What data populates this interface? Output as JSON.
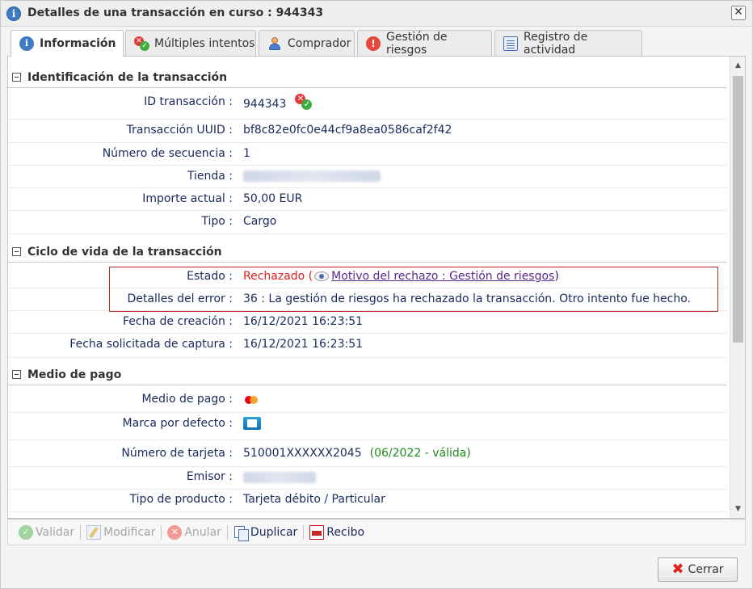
{
  "window": {
    "title": "Detalles de una transacción en curso : 944343",
    "close_symbol": "✕"
  },
  "tabs": [
    {
      "label": "Información"
    },
    {
      "label": "Múltiples intentos"
    },
    {
      "label": "Comprador"
    },
    {
      "label": "Gestión de riesgos"
    },
    {
      "label": "Registro de actividad"
    }
  ],
  "sections": {
    "identification": {
      "title": "Identificación de la transacción",
      "rows": [
        {
          "label": "ID transacción",
          "value": "944343"
        },
        {
          "label": "Transacción UUID",
          "value": "bf8c82e0fc0e44cf9a8ea0586caf2f42"
        },
        {
          "label": "Número de secuencia",
          "value": "1"
        },
        {
          "label": "Tienda",
          "value": ""
        },
        {
          "label": "Importe actual",
          "value": "50,00 EUR"
        },
        {
          "label": "Tipo",
          "value": "Cargo"
        }
      ]
    },
    "lifecycle": {
      "title": "Ciclo de vida de la transacción",
      "rows": [
        {
          "label": "Estado",
          "value": "Rechazado",
          "paren_open": " (",
          "link": "Motivo del rechazo : Gestión de riesgos",
          "paren_close": ")"
        },
        {
          "label": "Detalles del error",
          "value": "36 : La gestión de riesgos ha rechazado la transacción. Otro intento fue hecho."
        },
        {
          "label": "Fecha de creación",
          "value": "16/12/2021 16:23:51"
        },
        {
          "label": "Fecha solicitada de captura",
          "value": "16/12/2021 16:23:51"
        }
      ]
    },
    "payment": {
      "title": "Medio de pago",
      "rows": [
        {
          "label": "Medio de pago",
          "value": ""
        },
        {
          "label": "Marca por defecto",
          "value": ""
        },
        {
          "label": "Número de tarjeta",
          "value": "510001XXXXXX2045",
          "extra": "(06/2022 - válida)"
        },
        {
          "label": "Emisor",
          "value": ""
        },
        {
          "label": "Tipo de producto",
          "value": "Tarjeta débito / Particular"
        }
      ]
    }
  },
  "separator": ":",
  "toolbar": {
    "validate": "Validar",
    "modify": "Modificar",
    "cancel": "Anular",
    "duplicate": "Duplicar",
    "receipt": "Recibo"
  },
  "footer": {
    "close": "Cerrar"
  },
  "icons": {
    "title": "info-icon",
    "status_check": "check-icon",
    "status_fail": "x-icon",
    "eye": "eye-icon",
    "card_brand": "mastercard-icon",
    "default_brand": "cb-card-icon"
  },
  "colors": {
    "rejected": "#e0201b",
    "link": "#5a2a8f",
    "valid": "#1f8a1f",
    "error_box": "#c0282a"
  }
}
